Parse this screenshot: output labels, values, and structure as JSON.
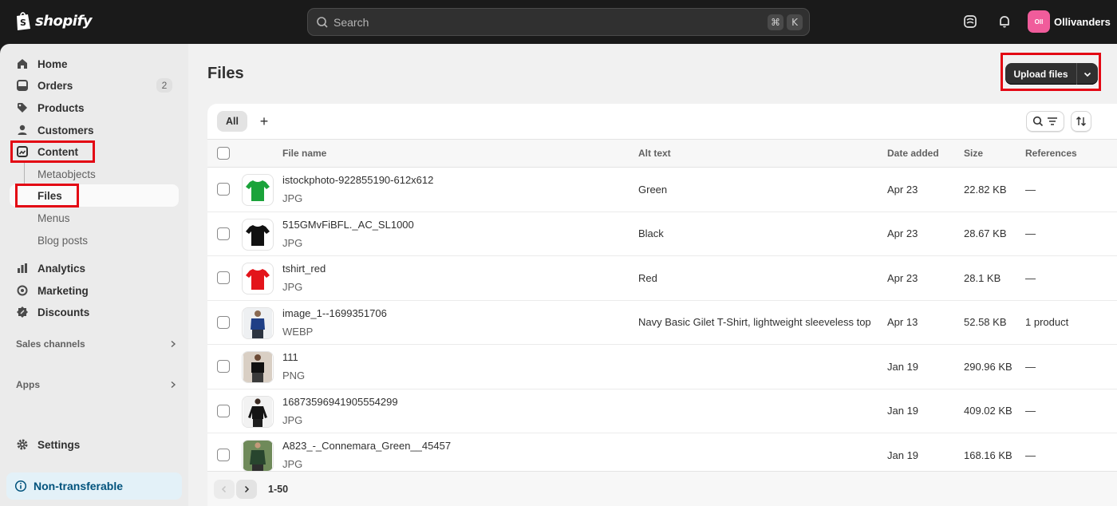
{
  "topbar": {
    "brand": "shopify",
    "search_placeholder": "Search",
    "shortcut_cmd": "⌘",
    "shortcut_key": "K",
    "store_initials": "Oll",
    "store_name": "Ollivanders"
  },
  "sidebar": {
    "items": [
      {
        "label": "Home",
        "icon": "home-icon"
      },
      {
        "label": "Orders",
        "icon": "orders-icon",
        "badge": "2"
      },
      {
        "label": "Products",
        "icon": "tag-icon"
      },
      {
        "label": "Customers",
        "icon": "person-icon"
      },
      {
        "label": "Content",
        "icon": "content-icon"
      }
    ],
    "content_sub": [
      "Metaobjects",
      "Files",
      "Menus",
      "Blog posts"
    ],
    "items2": [
      {
        "label": "Analytics",
        "icon": "chart-icon"
      },
      {
        "label": "Marketing",
        "icon": "target-icon"
      },
      {
        "label": "Discounts",
        "icon": "discount-icon"
      }
    ],
    "sales_channels": "Sales channels",
    "apps": "Apps",
    "settings": "Settings",
    "non_transferable": "Non-transferable"
  },
  "page": {
    "title": "Files",
    "upload_label": "Upload files"
  },
  "table": {
    "tab_all": "All",
    "tab_add": "+",
    "columns": [
      "File name",
      "Alt text",
      "Date added",
      "Size",
      "References"
    ],
    "rows": [
      {
        "name": "istockphoto-922855190-612x612",
        "type": "JPG",
        "alt": "Green",
        "date": "Apr 23",
        "size": "22.82 KB",
        "refs": "—",
        "thumb": "green-tshirt"
      },
      {
        "name": "515GMvFiBFL._AC_SL1000",
        "type": "JPG",
        "alt": "Black",
        "date": "Apr 23",
        "size": "28.67 KB",
        "refs": "—",
        "thumb": "black-tshirt"
      },
      {
        "name": "tshirt_red",
        "type": "JPG",
        "alt": "Red",
        "date": "Apr 23",
        "size": "28.1 KB",
        "refs": "—",
        "thumb": "red-tshirt"
      },
      {
        "name": "image_1--1699351706",
        "type": "WEBP",
        "alt": "Navy Basic Gilet T-Shirt, lightweight sleeveless top",
        "date": "Apr 13",
        "size": "52.58 KB",
        "refs": "1 product",
        "thumb": "navy-model"
      },
      {
        "name": "111",
        "type": "PNG",
        "alt": "",
        "date": "Jan 19",
        "size": "290.96 KB",
        "refs": "—",
        "thumb": "black-model"
      },
      {
        "name": "16873596941905554299",
        "type": "JPG",
        "alt": "",
        "date": "Jan 19",
        "size": "409.02 KB",
        "refs": "—",
        "thumb": "black-longsleeve-model"
      },
      {
        "name": "A823_-_Connemara_Green__45457",
        "type": "JPG",
        "alt": "",
        "date": "Jan 19",
        "size": "168.16 KB",
        "refs": "—",
        "thumb": "green-sweater-model"
      }
    ],
    "pagination": "1-50"
  },
  "colors": {
    "topbar_bg": "#1a1a1a",
    "highlight": "#e30613",
    "avatar": "#f05c9b"
  }
}
